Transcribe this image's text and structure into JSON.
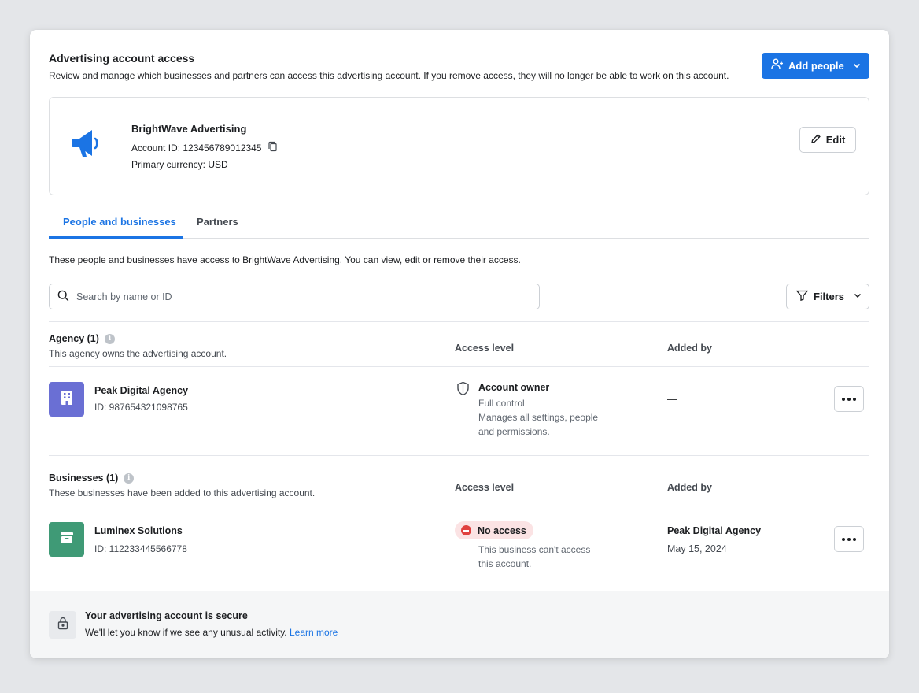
{
  "header": {
    "title": "Advertising account access",
    "description": "Review and manage which businesses and partners can access this advertising account. If you remove access, they will no longer be able to work on this account.",
    "add_people_label": "Add people"
  },
  "account": {
    "name": "BrightWave Advertising",
    "account_id_text": "Account ID: 123456789012345",
    "currency_text": "Primary currency: USD",
    "edit_label": "Edit",
    "icon": "megaphone-icon"
  },
  "tabs": [
    {
      "label": "People and businesses",
      "active": true
    },
    {
      "label": "Partners",
      "active": false
    }
  ],
  "intro": "These people and businesses have access to BrightWave Advertising. You can view, edit or remove their access.",
  "search": {
    "placeholder": "Search by name or ID"
  },
  "filters_label": "Filters",
  "columns": {
    "access_level": "Access level",
    "added_by": "Added by"
  },
  "agency": {
    "title": "Agency (1)",
    "description": "This agency owns the advertising account.",
    "rows": [
      {
        "name": "Peak Digital Agency",
        "id_text": "ID: 987654321098765",
        "access_title": "Account owner",
        "access_line1": "Full control",
        "access_line2": "Manages all settings, people",
        "access_line3": "and permissions.",
        "added_by": "—",
        "avatar_color": "#6a6fd4"
      }
    ]
  },
  "businesses": {
    "title": "Businesses (1)",
    "description": "These businesses have been added to this advertising account.",
    "rows": [
      {
        "name": "Luminex Solutions",
        "id_text": "ID: 112233445566778",
        "access_title": "No access",
        "access_line1": "This business can't access",
        "access_line2": "this account.",
        "added_by": "Peak Digital Agency",
        "added_date": "May 15, 2024",
        "avatar_color": "#3f9a76"
      }
    ]
  },
  "footer": {
    "title": "Your advertising account is secure",
    "description": "We'll let you know if we see any unusual activity.",
    "link": "Learn more"
  },
  "colors": {
    "accent": "#1b74e4",
    "no_access_bg": "#fbe3e4",
    "no_access_dot": "#e0413f"
  }
}
